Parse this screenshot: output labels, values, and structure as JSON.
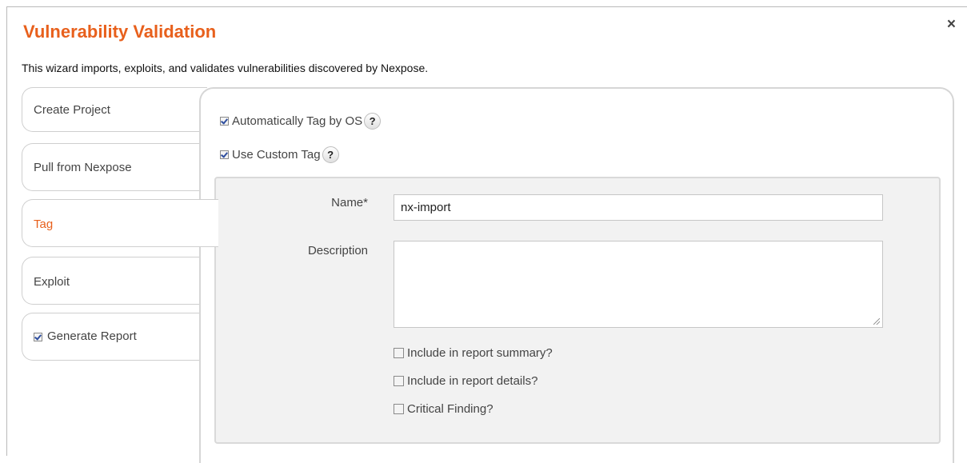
{
  "dialog": {
    "title": "Vulnerability Validation",
    "subtitle": "This wizard imports, exploits, and validates vulnerabilities discovered by Nexpose.",
    "close_label": "×"
  },
  "tabs": [
    {
      "label": "Create Project",
      "active": false,
      "checkbox": false
    },
    {
      "label": "Pull from Nexpose",
      "active": false,
      "checkbox": false
    },
    {
      "label": "Tag",
      "active": true,
      "checkbox": false
    },
    {
      "label": "Exploit",
      "active": false,
      "checkbox": false
    },
    {
      "label": "Generate Report",
      "active": false,
      "checkbox": true,
      "checked": true
    }
  ],
  "options": {
    "auto_tag_label": "Automatically Tag by OS",
    "auto_tag_checked": true,
    "custom_tag_label": "Use Custom Tag",
    "custom_tag_checked": true,
    "help_glyph": "?"
  },
  "custom_tag": {
    "name_label": "Name*",
    "name_value": "nx-import",
    "description_label": "Description",
    "description_value": "",
    "include_summary_label": "Include in report summary?",
    "include_summary_checked": false,
    "include_details_label": "Include in report details?",
    "include_details_checked": false,
    "critical_label": "Critical Finding?",
    "critical_checked": false
  },
  "colors": {
    "accent": "#e8601c"
  }
}
